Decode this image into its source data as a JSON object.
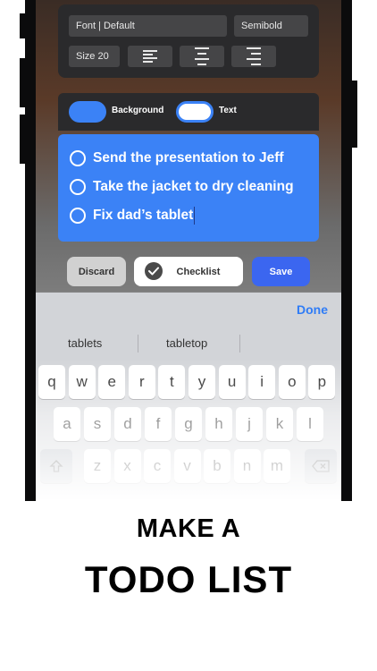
{
  "font_panel": {
    "font_label": "Font | Default",
    "weight_label": "Semibold",
    "size_label": "Size 20",
    "align_icons": [
      "align-left-icon",
      "align-center-icon",
      "align-right-icon"
    ]
  },
  "color_panel": {
    "background_label": "Background",
    "text_label": "Text",
    "background_color": "#3b82f6",
    "text_color": "#ffffff"
  },
  "note": {
    "items": [
      "Send the presentation to Jeff",
      "Take the jacket to dry cleaning",
      "Fix dad’s tablet"
    ],
    "background_color": "#3b82f6"
  },
  "actions": {
    "discard_label": "Discard",
    "checklist_label": "Checklist",
    "save_label": "Save"
  },
  "keyboard": {
    "done_label": "Done",
    "suggestions": [
      "tablets",
      "tabletop"
    ],
    "row1": [
      "q",
      "w",
      "e",
      "r",
      "t",
      "y",
      "u",
      "i",
      "o",
      "p"
    ],
    "row2": [
      "a",
      "s",
      "d",
      "f",
      "g",
      "h",
      "j",
      "k",
      "l"
    ],
    "row3": [
      "z",
      "x",
      "c",
      "v",
      "b",
      "n",
      "m"
    ]
  },
  "headline": {
    "line1": "MAKE A",
    "line2": "TODO LIST"
  }
}
